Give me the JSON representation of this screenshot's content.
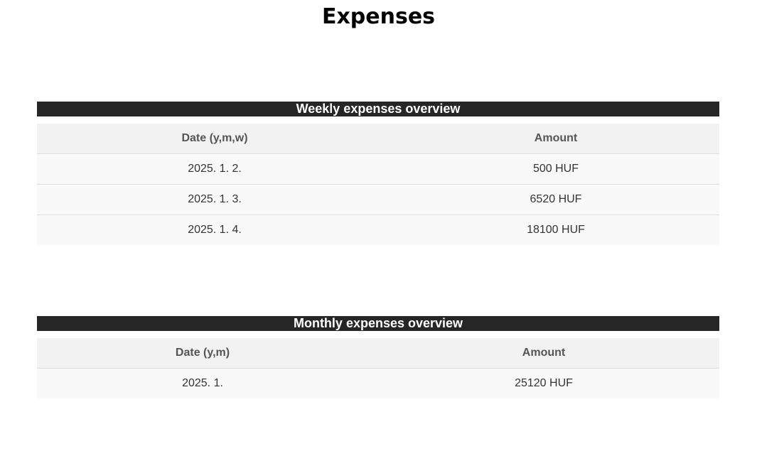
{
  "page": {
    "title": "Expenses"
  },
  "weekly": {
    "title": "Weekly expenses overview",
    "columns": [
      "Date (y,m,w)",
      "Amount"
    ],
    "rows": [
      {
        "date": "2025. 1. 2.",
        "amount": "500 HUF"
      },
      {
        "date": "2025. 1. 3.",
        "amount": "6520 HUF"
      },
      {
        "date": "2025. 1. 4.",
        "amount": "18100 HUF"
      }
    ]
  },
  "monthly": {
    "title": "Monthly expenses overview",
    "columns": [
      "Date (y,m)",
      "Amount"
    ],
    "rows": [
      {
        "date": "2025. 1.",
        "amount": "25120 HUF"
      }
    ]
  },
  "colors": {
    "header_bar": "#262626",
    "table_head": "#f2f2f2",
    "table_row": "#f9f9f9"
  }
}
